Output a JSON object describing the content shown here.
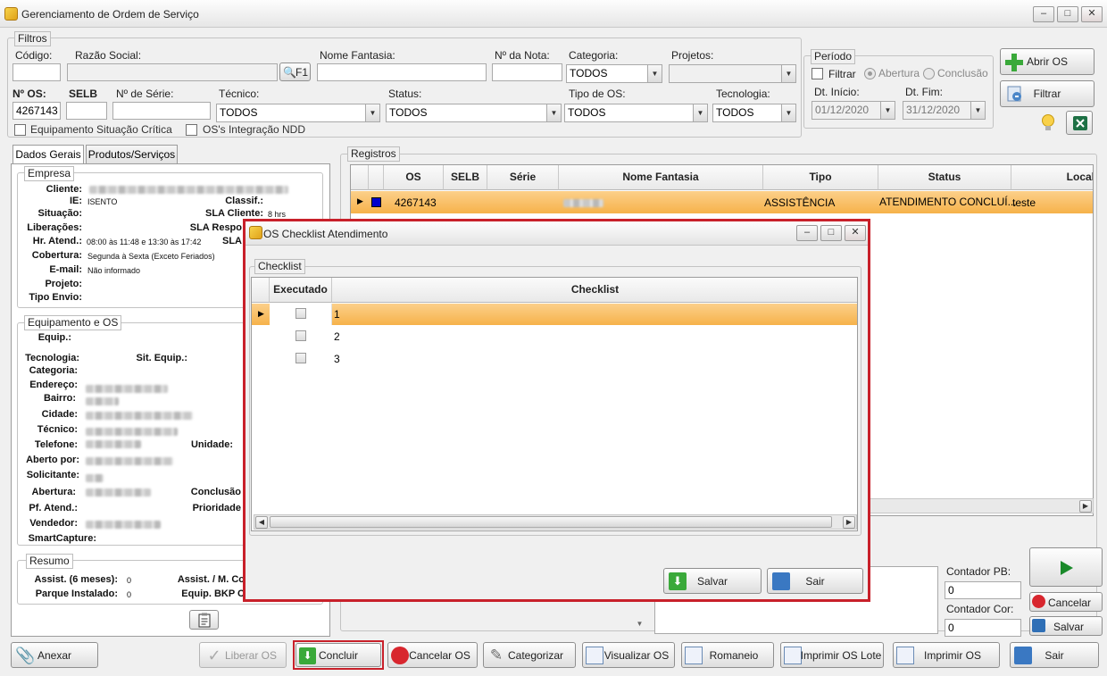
{
  "window": {
    "title": "Gerenciamento de Ordem de Serviço",
    "minimize": "–",
    "maximize": "□",
    "close": "✕"
  },
  "filters": {
    "group_label": "Filtros",
    "codigo_label": "Código:",
    "razao_label": "Razão Social:",
    "f1_label": "F1",
    "fantasia_label": "Nome Fantasia:",
    "nota_label": "Nº da Nota:",
    "categoria_label": "Categoria:",
    "categoria_value": "TODOS",
    "projetos_label": "Projetos:",
    "os_label": "Nº OS:",
    "os_value": "4267143",
    "selb_label": "SELB",
    "serie_label": "Nº de Série:",
    "tecnico_label": "Técnico:",
    "tecnico_value": "TODOS",
    "status_label": "Status:",
    "status_value": "TODOS",
    "tipo_label": "Tipo de OS:",
    "tipo_value": "TODOS",
    "tecnologia_label": "Tecnologia:",
    "tecnologia_value": "TODOS",
    "equip_critica_label": "Equipamento Situação Crítica",
    "integracao_label": "OS's Integração NDD"
  },
  "periodo": {
    "group_label": "Período",
    "filtrar_label": "Filtrar",
    "abertura_label": "Abertura",
    "conclusao_label": "Conclusão",
    "inicio_label": "Dt. Início:",
    "inicio_value": "01/12/2020",
    "fim_label": "Dt. Fim:",
    "fim_value": "31/12/2020"
  },
  "right_buttons": {
    "abrir_os": "Abrir OS",
    "filtrar": "Filtrar"
  },
  "tabs": {
    "dados_gerais": "Dados Gerais",
    "produtos": "Produtos/Serviços"
  },
  "empresa": {
    "group_label": "Empresa",
    "cliente_label": "Cliente:",
    "ie_label": "IE:",
    "ie_value": "ISENTO",
    "classif_label": "Classif.:",
    "situacao_label": "Situação:",
    "sla_cliente_label": "SLA Cliente:",
    "sla_cliente_value": "8 hrs",
    "liberacoes_label": "Liberações:",
    "sla_resp_label": "SLA Respo",
    "hr_atend_label": "Hr. Atend.:",
    "hr_atend_value": "08:00 às 11:48 e 13:30 às 17:42",
    "sla_label": "SLA",
    "cobertura_label": "Cobertura:",
    "cobertura_value": "Segunda à Sexta (Exceto Feriados)",
    "email_label": "E-mail:",
    "email_value": "Não informado",
    "projeto_label": "Projeto:",
    "tipo_envio_label": "Tipo Envio:"
  },
  "equipamento": {
    "group_label": "Equipamento e OS",
    "equip_label": "Equip.:",
    "tecnologia_label": "Tecnologia:",
    "sit_equip_label": "Sit. Equip.:",
    "categoria_label": "Categoria:",
    "endereco_label": "Endereço:",
    "bairro_label": "Bairro:",
    "cidade_label": "Cidade:",
    "tecnico_label": "Técnico:",
    "telefone_label": "Telefone:",
    "unidade_label": "Unidade:",
    "aberto_label": "Aberto por:",
    "solicitante_label": "Solicitante:",
    "abertura_label": "Abertura:",
    "conclusao_label": "Conclusão",
    "pf_atend_label": "Pf. Atend.:",
    "prioridade_label": "Prioridade",
    "vendedor_label": "Vendedor:",
    "smartcapture_label": "SmartCapture:"
  },
  "resumo": {
    "group_label": "Resumo",
    "assist_label": "Assist. (6 meses):",
    "assist_value": "0",
    "assist_m_label": "Assist. / M. Co",
    "parque_label": "Parque Instalado:",
    "parque_value": "0",
    "equip_bkp_label": "Equip. BKP C"
  },
  "registros": {
    "group_label": "Registros",
    "columns": [
      "OS",
      "SELB",
      "Série",
      "Nome Fantasia",
      "Tipo",
      "Status",
      "Local"
    ],
    "rows": [
      {
        "os": "4267143",
        "selb": "",
        "serie": "",
        "fantasia": "",
        "tipo": "ASSISTÊNCIA",
        "status": "ATENDIMENTO  CONCLUÍ...",
        "local": "teste"
      }
    ]
  },
  "contadores": {
    "pb_label": "Contador PB:",
    "pb_value": "0",
    "cor_label": "Contador Cor:",
    "cor_value": "0"
  },
  "side_actions": {
    "cancelar": "Cancelar",
    "salvar": "Salvar"
  },
  "bottom_bar": {
    "anexar": "Anexar",
    "liberar": "Liberar OS",
    "concluir": "Concluir",
    "cancelar_os": "Cancelar OS",
    "categorizar": "Categorizar",
    "visualizar": "Visualizar OS",
    "romaneio": "Romaneio",
    "imprimir_lote": "Imprimir OS Lote",
    "imprimir": "Imprimir OS",
    "sair": "Sair"
  },
  "modal": {
    "title": "OS Checklist Atendimento",
    "group_label": "Checklist",
    "col_executado": "Executado",
    "col_checklist": "Checklist",
    "rows": [
      {
        "label": "1",
        "checked": false
      },
      {
        "label": "2",
        "checked": false
      },
      {
        "label": "3",
        "checked": false
      }
    ],
    "salvar": "Salvar",
    "sair": "Sair"
  },
  "colors": {
    "highlight_red": "#c8202a",
    "row_selected": "#f6b24a",
    "status_blue": "#0000cc"
  }
}
